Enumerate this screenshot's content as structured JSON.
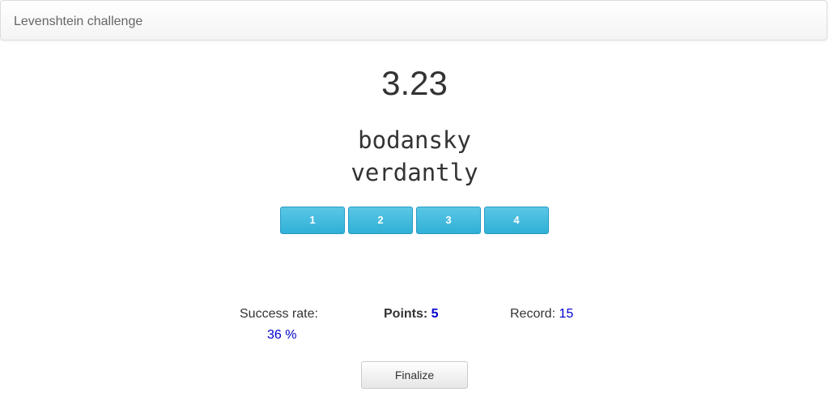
{
  "app": {
    "title": "Levenshtein challenge"
  },
  "game": {
    "timer": "3.23",
    "word1": "bodansky",
    "word2": "verdantly",
    "answers": [
      "1",
      "2",
      "3",
      "4"
    ]
  },
  "stats": {
    "success_label": "Success rate:",
    "success_value": "36 %",
    "points_label": "Points:",
    "points_value": "5",
    "record_label": "Record:",
    "record_value": "15"
  },
  "actions": {
    "finalize_label": "Finalize"
  },
  "colors": {
    "answer_button": "#39b3d7",
    "stat_value": "#0000cc"
  }
}
